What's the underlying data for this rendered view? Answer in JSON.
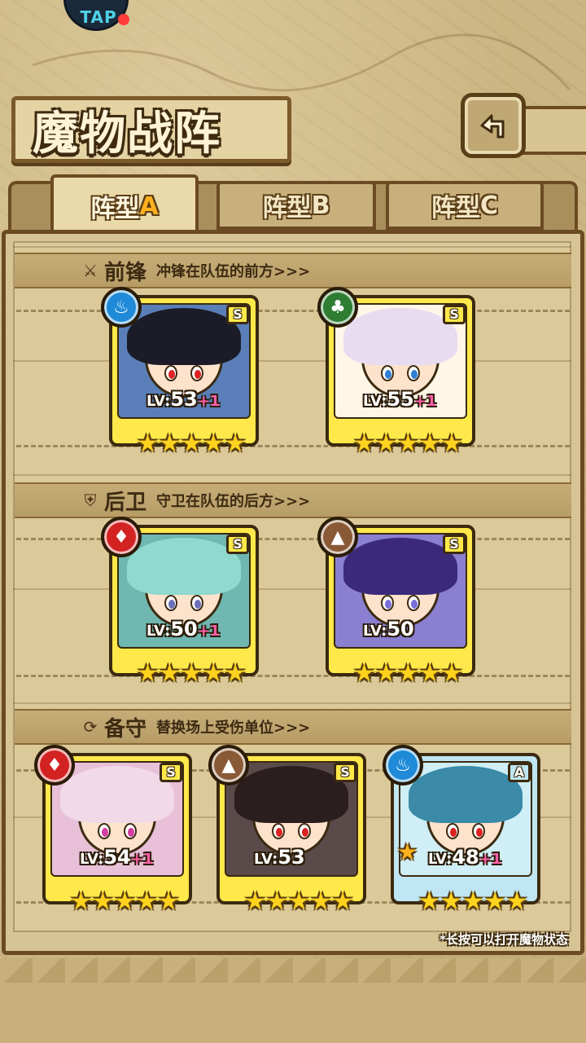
{
  "title": "魔物战阵",
  "logo": {
    "text": "TAP"
  },
  "tabs": [
    {
      "label": "阵型",
      "letter": "A",
      "active": true
    },
    {
      "label": "阵型",
      "letter": "B",
      "active": false
    },
    {
      "label": "阵型",
      "letter": "C",
      "active": false
    }
  ],
  "sections": [
    {
      "title": "前锋",
      "desc": "冲锋在队伍的前方>>>",
      "icon": "sword-icon",
      "cards": [
        {
          "element": "water",
          "rank": "S",
          "level": "53",
          "plus": "+1",
          "stars": 5,
          "iris": "#d22",
          "hair": "#1c1c28",
          "bg": "#5a7fb8"
        },
        {
          "element": "wood",
          "rank": "S",
          "level": "55",
          "plus": "+1",
          "stars": 5,
          "iris": "#2f7fd6",
          "hair": "#e8dcf0",
          "bg": "#fff6e8"
        }
      ]
    },
    {
      "title": "后卫",
      "desc": "守卫在队伍的后方>>>",
      "icon": "shield-icon",
      "cards": [
        {
          "element": "fire",
          "rank": "S",
          "level": "50",
          "plus": "+1",
          "stars": 5,
          "iris": "#6a6fb8",
          "hair": "#8fd9cf",
          "bg": "#6fb7b0"
        },
        {
          "element": "earth",
          "rank": "S",
          "level": "50",
          "plus": "",
          "stars": 5,
          "iris": "#7a6fd8",
          "hair": "#3b2a7a",
          "bg": "#8a7fd0"
        }
      ]
    },
    {
      "title": "备守",
      "desc": "替换场上受伤单位>>>",
      "icon": "swap-icon",
      "cards": [
        {
          "element": "fire",
          "rank": "S",
          "level": "54",
          "plus": "+1",
          "stars": 5,
          "iris": "#d33ca0",
          "hair": "#f2d9e8",
          "bg": "#e8c0d8"
        },
        {
          "element": "earth",
          "rank": "S",
          "level": "53",
          "plus": "",
          "stars": 5,
          "iris": "#d22",
          "hair": "#2a1e1e",
          "bg": "#5a4a4a"
        },
        {
          "element": "water",
          "rank": "A",
          "level": "48",
          "plus": "+1",
          "stars": 5,
          "iris": "#d22",
          "hair": "#3a8aa8",
          "bg": "#cfeef5",
          "leader": true
        }
      ]
    }
  ],
  "lv_prefix": "LV:",
  "hint": "*长按可以打开魔物状态",
  "colors": {
    "rank_s": "#ffe94a",
    "rank_a": "#bfe6f2",
    "star": "#ffd21e",
    "plus": "#ff5fa8",
    "tab_active_letter": "#ffb21e"
  }
}
